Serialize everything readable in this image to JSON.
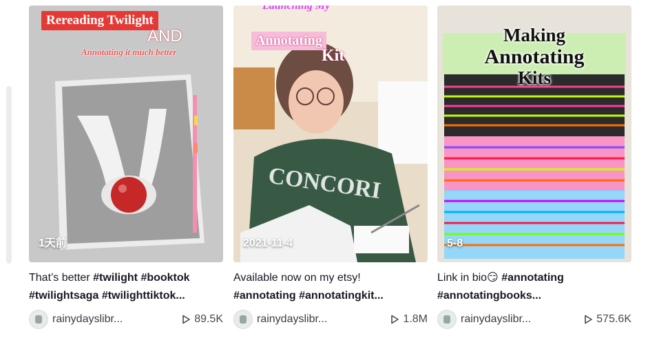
{
  "videos": [
    {
      "overlay": {
        "title": "Rereading Twilight",
        "and": "AND",
        "subtitle": "Annotating it much better"
      },
      "date": "1天前",
      "desc_text": "That’s better ",
      "tags": [
        "#twilight",
        "#booktok",
        "#twilightsaga",
        "#twilighttiktok..."
      ],
      "author": "rainydayslibr...",
      "plays": "89.5K"
    },
    {
      "overlay": {
        "top": "Launching My",
        "tag": "Annotating",
        "kit": "Kit"
      },
      "date": "2021-11-4",
      "desc_text": "Available now on my etsy!",
      "tags": [
        "#annotating",
        "#annotatingkit..."
      ],
      "author": "rainydayslibr...",
      "plays": "1.8M"
    },
    {
      "overlay": {
        "line1": "Making",
        "line2": "Annotating",
        "line3": "Kits"
      },
      "date": "5-8",
      "desc_text": "Link in bio",
      "emoji": "😏",
      "tags": [
        "#annotating",
        "#annotatingbooks..."
      ],
      "author": "rainydayslibr...",
      "plays": "575.6K"
    }
  ],
  "icons": {
    "play": "play-icon",
    "avatar": "avatar"
  }
}
